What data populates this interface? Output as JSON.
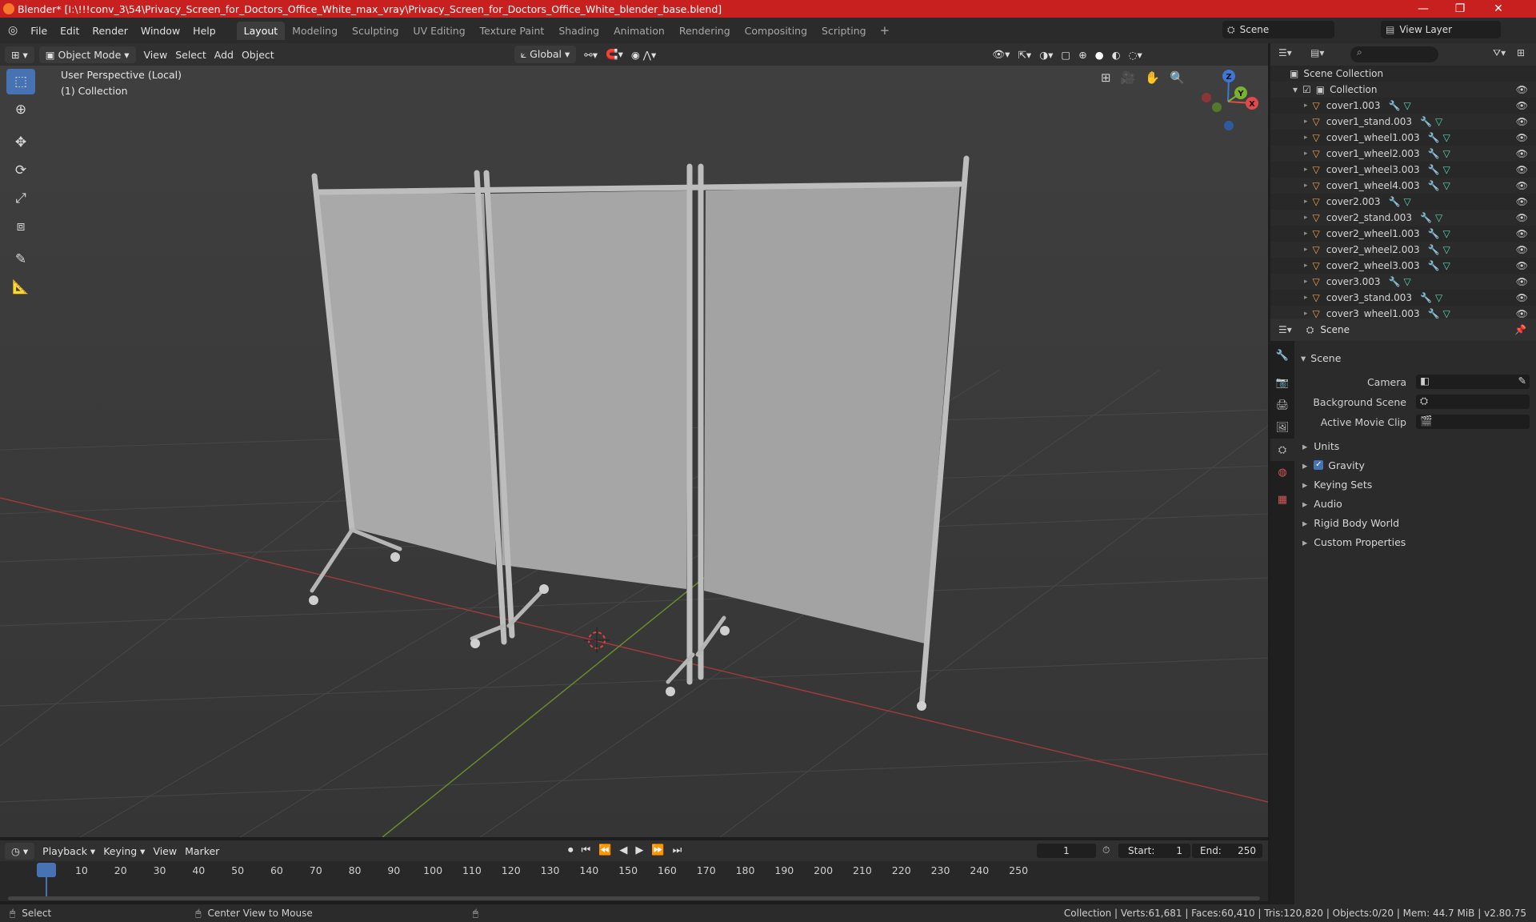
{
  "window": {
    "title": "Blender* [I:\\!!!conv_3\\54\\Privacy_Screen_for_Doctors_Office_White_max_vray\\Privacy_Screen_for_Doctors_Office_White_blender_base.blend]",
    "minimize": "—",
    "maximize": "❐",
    "close": "✕"
  },
  "menu": [
    "File",
    "Edit",
    "Render",
    "Window",
    "Help"
  ],
  "workspaces": [
    "Layout",
    "Modeling",
    "Sculpting",
    "UV Editing",
    "Texture Paint",
    "Shading",
    "Animation",
    "Rendering",
    "Compositing",
    "Scripting"
  ],
  "active_workspace": "Layout",
  "scene_selector": "Scene",
  "view_layer_selector": "View Layer",
  "viewport_header": {
    "mode": "Object Mode",
    "menus": [
      "View",
      "Select",
      "Add",
      "Object"
    ],
    "transform_orientation": "Global"
  },
  "viewport": {
    "perspective_label": "User Perspective (Local)",
    "collection_label": "(1) Collection",
    "gizmo_axes": {
      "x": "X",
      "y": "Y",
      "z": "Z"
    }
  },
  "outliner": {
    "root": "Scene Collection",
    "collection": "Collection",
    "items": [
      "cover1.003",
      "cover1_stand.003",
      "cover1_wheel1.003",
      "cover1_wheel2.003",
      "cover1_wheel3.003",
      "cover1_wheel4.003",
      "cover2.003",
      "cover2_stand.003",
      "cover2_wheel1.003",
      "cover2_wheel2.003",
      "cover2_wheel3.003",
      "cover3.003",
      "cover3_stand.003",
      "cover3_wheel1.003"
    ]
  },
  "properties": {
    "header": "Scene",
    "panel_title": "Scene",
    "fields": [
      {
        "label": "Camera",
        "icon": "camera-icon"
      },
      {
        "label": "Background Scene",
        "icon": "scene-icon"
      },
      {
        "label": "Active Movie Clip",
        "icon": "clip-icon"
      }
    ],
    "subpanels": [
      "Units",
      "Gravity",
      "Keying Sets",
      "Audio",
      "Rigid Body World",
      "Custom Properties"
    ],
    "gravity_checked": true
  },
  "timeline": {
    "menus": [
      "Playback",
      "Keying",
      "View",
      "Marker"
    ],
    "current_frame": "1",
    "start_label": "Start:",
    "start": "1",
    "end_label": "End:",
    "end": "250",
    "ruler": [
      "1",
      "10",
      "20",
      "30",
      "40",
      "50",
      "60",
      "70",
      "80",
      "90",
      "100",
      "110",
      "120",
      "130",
      "140",
      "150",
      "160",
      "170",
      "180",
      "190",
      "200",
      "210",
      "220",
      "230",
      "240",
      "250"
    ]
  },
  "statusbar": {
    "left": "Select",
    "middle": "Center View to Mouse",
    "right": "Collection | Verts:61,681 | Faces:60,410 | Tris:120,820 | Objects:0/20 | Mem: 44.7 MiB | v2.80.75"
  }
}
